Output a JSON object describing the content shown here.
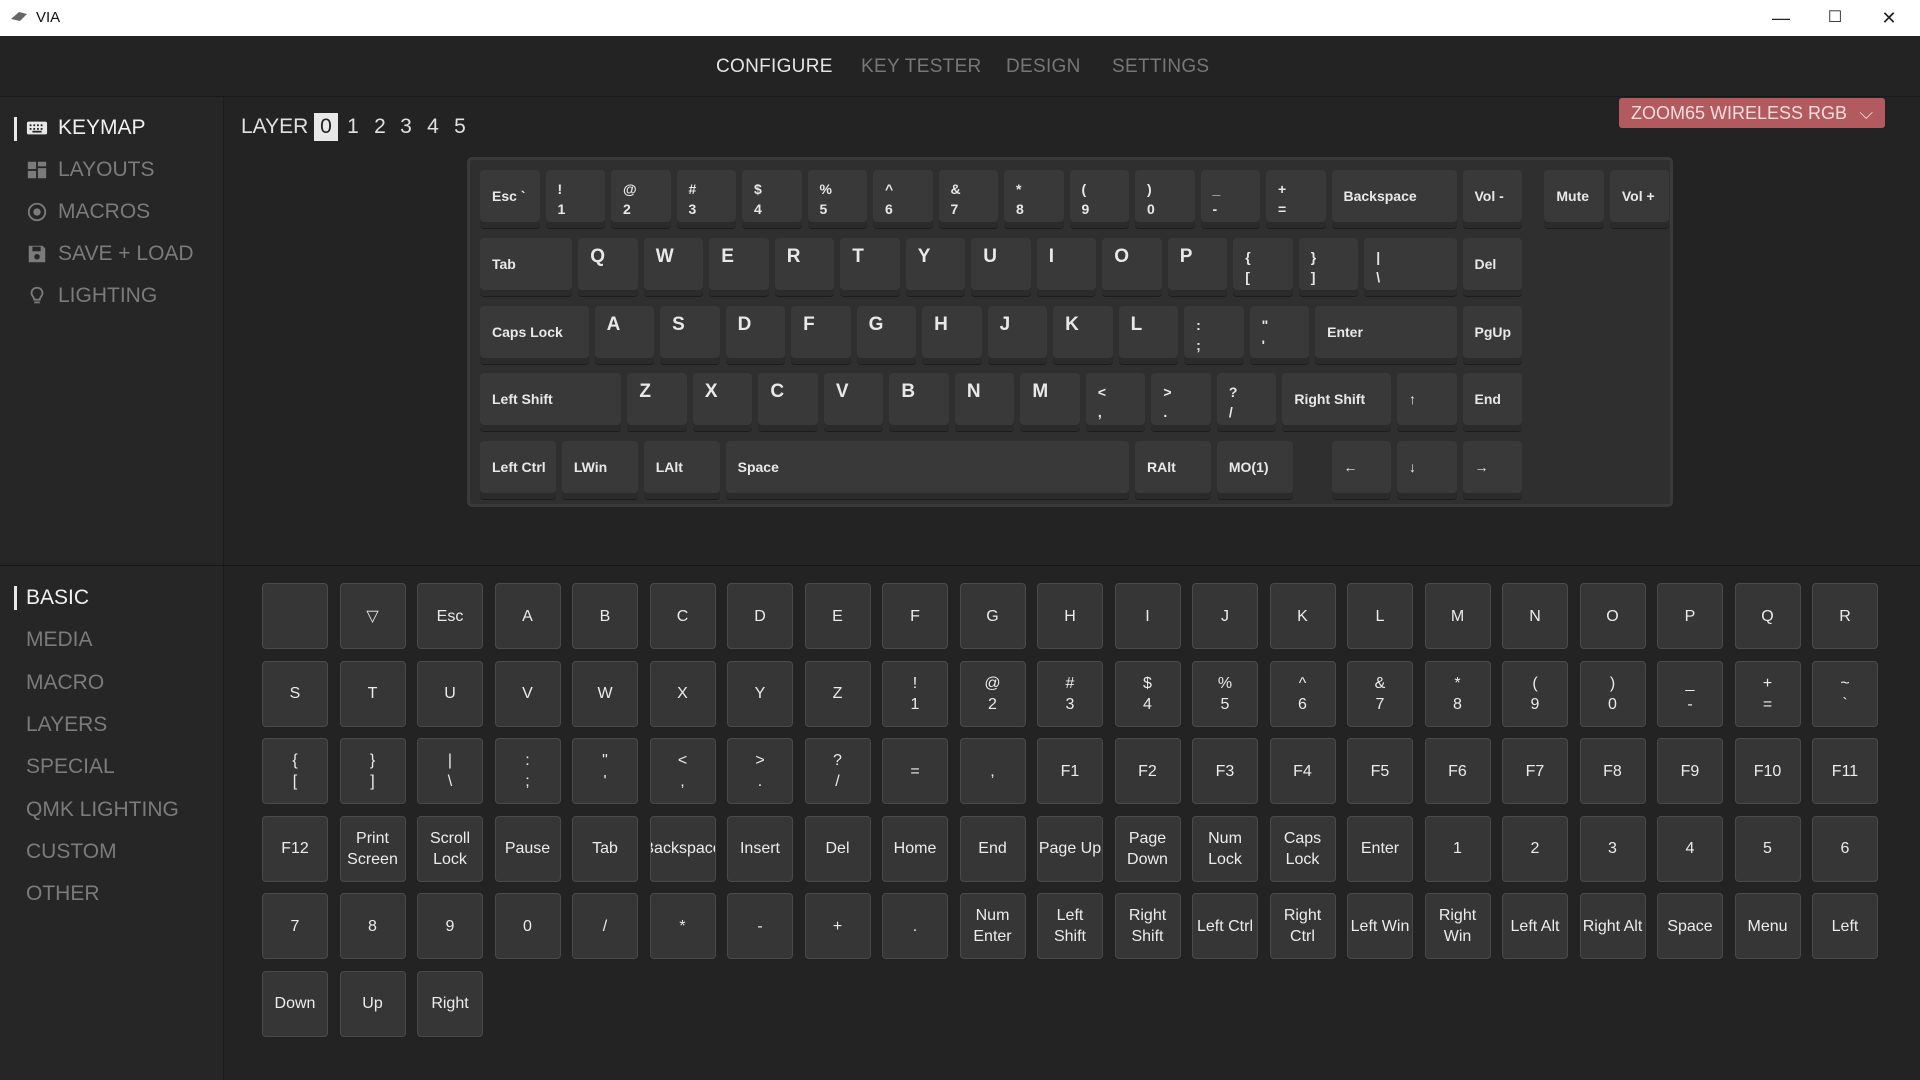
{
  "app": {
    "title": "VIA",
    "minimize": "—",
    "maximize": "☐",
    "close": "✕"
  },
  "nav": {
    "tabs": [
      "CONFIGURE",
      "KEY TESTER",
      "DESIGN",
      "SETTINGS"
    ],
    "active": 0
  },
  "sidebar": {
    "items": [
      {
        "label": "KEYMAP",
        "icon": "keyboard-icon"
      },
      {
        "label": "LAYOUTS",
        "icon": "layouts-icon"
      },
      {
        "label": "MACROS",
        "icon": "macros-icon"
      },
      {
        "label": "SAVE + LOAD",
        "icon": "save-icon"
      },
      {
        "label": "LIGHTING",
        "icon": "bulb-icon"
      }
    ],
    "active": 0
  },
  "layers": {
    "label": "LAYER",
    "numbers": [
      "0",
      "1",
      "2",
      "3",
      "4",
      "5"
    ],
    "active": 0
  },
  "device": {
    "name": "ZOOM65 WIRELESS RGB",
    "chevron": "⌵"
  },
  "keyboard": {
    "rows": [
      [
        {
          "t1": "Esc `",
          "w": 1
        },
        {
          "t1": "!",
          "t2": "1",
          "w": 1
        },
        {
          "t1": "@",
          "t2": "2",
          "w": 1
        },
        {
          "t1": "#",
          "t2": "3",
          "w": 1
        },
        {
          "t1": "$",
          "t2": "4",
          "w": 1
        },
        {
          "t1": "%",
          "t2": "5",
          "w": 1
        },
        {
          "t1": "^",
          "t2": "6",
          "w": 1
        },
        {
          "t1": "&",
          "t2": "7",
          "w": 1
        },
        {
          "t1": "*",
          "t2": "8",
          "w": 1
        },
        {
          "t1": "(",
          "t2": "9",
          "w": 1
        },
        {
          "t1": ")",
          "t2": "0",
          "w": 1
        },
        {
          "t1": "_",
          "t2": "-",
          "w": 1
        },
        {
          "t1": "+",
          "t2": "=",
          "w": 1
        },
        {
          "t1": "Backspace",
          "w": 2
        },
        {
          "t1": "Vol -",
          "w": 1
        },
        {
          "t1": "Mute",
          "w": 1,
          "gap": 0.25
        },
        {
          "t1": "Vol +",
          "w": 1
        }
      ],
      [
        {
          "t1": "Tab",
          "w": 1.5
        },
        {
          "t1": "Q",
          "big": true,
          "w": 1
        },
        {
          "t1": "W",
          "big": true,
          "w": 1
        },
        {
          "t1": "E",
          "big": true,
          "w": 1
        },
        {
          "t1": "R",
          "big": true,
          "w": 1
        },
        {
          "t1": "T",
          "big": true,
          "w": 1
        },
        {
          "t1": "Y",
          "big": true,
          "w": 1
        },
        {
          "t1": "U",
          "big": true,
          "w": 1
        },
        {
          "t1": "I",
          "big": true,
          "w": 1
        },
        {
          "t1": "O",
          "big": true,
          "w": 1
        },
        {
          "t1": "P",
          "big": true,
          "w": 1
        },
        {
          "t1": "{",
          "t2": "[",
          "w": 1
        },
        {
          "t1": "}",
          "t2": "]",
          "w": 1
        },
        {
          "t1": "|",
          "t2": "\\",
          "w": 1.5
        },
        {
          "t1": "Del",
          "w": 1
        }
      ],
      [
        {
          "t1": "Caps Lock",
          "w": 1.75
        },
        {
          "t1": "A",
          "big": true,
          "w": 1
        },
        {
          "t1": "S",
          "big": true,
          "w": 1
        },
        {
          "t1": "D",
          "big": true,
          "w": 1
        },
        {
          "t1": "F",
          "big": true,
          "w": 1
        },
        {
          "t1": "G",
          "big": true,
          "w": 1
        },
        {
          "t1": "H",
          "big": true,
          "w": 1
        },
        {
          "t1": "J",
          "big": true,
          "w": 1
        },
        {
          "t1": "K",
          "big": true,
          "w": 1
        },
        {
          "t1": "L",
          "big": true,
          "w": 1
        },
        {
          "t1": ":",
          "t2": ";",
          "w": 1
        },
        {
          "t1": "\"",
          "t2": "'",
          "w": 1
        },
        {
          "t1": "Enter",
          "w": 2.25
        },
        {
          "t1": "PgUp",
          "w": 1
        }
      ],
      [
        {
          "t1": "Left Shift",
          "w": 2.25
        },
        {
          "t1": "Z",
          "big": true,
          "w": 1
        },
        {
          "t1": "X",
          "big": true,
          "w": 1
        },
        {
          "t1": "C",
          "big": true,
          "w": 1
        },
        {
          "t1": "V",
          "big": true,
          "w": 1
        },
        {
          "t1": "B",
          "big": true,
          "w": 1
        },
        {
          "t1": "N",
          "big": true,
          "w": 1
        },
        {
          "t1": "M",
          "big": true,
          "w": 1
        },
        {
          "t1": "<",
          "t2": ",",
          "w": 1
        },
        {
          "t1": ">",
          "t2": ".",
          "w": 1
        },
        {
          "t1": "?",
          "t2": "/",
          "w": 1
        },
        {
          "t1": "Right Shift",
          "w": 1.75
        },
        {
          "t1": "↑",
          "w": 1
        },
        {
          "t1": "End",
          "w": 1
        }
      ],
      [
        {
          "t1": "Left Ctrl",
          "w": 1.25
        },
        {
          "t1": "LWin",
          "w": 1.25
        },
        {
          "t1": "LAlt",
          "w": 1.25
        },
        {
          "t1": "Space",
          "w": 6.25
        },
        {
          "t1": "RAlt",
          "w": 1.25
        },
        {
          "t1": "MO(1)",
          "w": 1.25
        },
        {
          "t1": "←",
          "w": 1,
          "gap": 0.5
        },
        {
          "t1": "↓",
          "w": 1
        },
        {
          "t1": "→",
          "w": 1
        }
      ]
    ]
  },
  "categories": {
    "items": [
      "BASIC",
      "MEDIA",
      "MACRO",
      "LAYERS",
      "SPECIAL",
      "QMK LIGHTING",
      "CUSTOM",
      "OTHER"
    ],
    "active": 0
  },
  "palette": [
    {
      "a": ""
    },
    {
      "a": "▽"
    },
    {
      "a": "Esc"
    },
    {
      "a": "A"
    },
    {
      "a": "B"
    },
    {
      "a": "C"
    },
    {
      "a": "D"
    },
    {
      "a": "E"
    },
    {
      "a": "F"
    },
    {
      "a": "G"
    },
    {
      "a": "H"
    },
    {
      "a": "I"
    },
    {
      "a": "J"
    },
    {
      "a": "K"
    },
    {
      "a": "L"
    },
    {
      "a": "M"
    },
    {
      "a": "N"
    },
    {
      "a": "O"
    },
    {
      "a": "P"
    },
    {
      "a": "Q"
    },
    {
      "a": "R"
    },
    {
      "a": "S"
    },
    {
      "a": "T"
    },
    {
      "a": "U"
    },
    {
      "a": "V"
    },
    {
      "a": "W"
    },
    {
      "a": "X"
    },
    {
      "a": "Y"
    },
    {
      "a": "Z"
    },
    {
      "a": "!",
      "b": "1"
    },
    {
      "a": "@",
      "b": "2"
    },
    {
      "a": "#",
      "b": "3"
    },
    {
      "a": "$",
      "b": "4"
    },
    {
      "a": "%",
      "b": "5"
    },
    {
      "a": "^",
      "b": "6"
    },
    {
      "a": "&",
      "b": "7"
    },
    {
      "a": "*",
      "b": "8"
    },
    {
      "a": "(",
      "b": "9"
    },
    {
      "a": ")",
      "b": "0"
    },
    {
      "a": "_",
      "b": "-"
    },
    {
      "a": "+",
      "b": "="
    },
    {
      "a": "~",
      "b": "`"
    },
    {
      "a": "{",
      "b": "["
    },
    {
      "a": "}",
      "b": "]"
    },
    {
      "a": "|",
      "b": "\\"
    },
    {
      "a": ":",
      "b": ";"
    },
    {
      "a": "\"",
      "b": "'"
    },
    {
      "a": "<",
      "b": ","
    },
    {
      "a": ">",
      "b": "."
    },
    {
      "a": "?",
      "b": "/"
    },
    {
      "a": "="
    },
    {
      "a": ","
    },
    {
      "a": "F1"
    },
    {
      "a": "F2"
    },
    {
      "a": "F3"
    },
    {
      "a": "F4"
    },
    {
      "a": "F5"
    },
    {
      "a": "F6"
    },
    {
      "a": "F7"
    },
    {
      "a": "F8"
    },
    {
      "a": "F9"
    },
    {
      "a": "F10"
    },
    {
      "a": "F11"
    },
    {
      "a": "F12"
    },
    {
      "a": "Print",
      "b": "Screen"
    },
    {
      "a": "Scroll",
      "b": "Lock"
    },
    {
      "a": "Pause"
    },
    {
      "a": "Tab"
    },
    {
      "a": "Backspace"
    },
    {
      "a": "Insert"
    },
    {
      "a": "Del"
    },
    {
      "a": "Home"
    },
    {
      "a": "End"
    },
    {
      "a": "Page Up"
    },
    {
      "a": "Page",
      "b": "Down"
    },
    {
      "a": "Num",
      "b": "Lock"
    },
    {
      "a": "Caps",
      "b": "Lock"
    },
    {
      "a": "Enter"
    },
    {
      "a": "1"
    },
    {
      "a": "2"
    },
    {
      "a": "3"
    },
    {
      "a": "4"
    },
    {
      "a": "5"
    },
    {
      "a": "6"
    },
    {
      "a": "7"
    },
    {
      "a": "8"
    },
    {
      "a": "9"
    },
    {
      "a": "0"
    },
    {
      "a": "/"
    },
    {
      "a": "*"
    },
    {
      "a": "-"
    },
    {
      "a": "+"
    },
    {
      "a": "."
    },
    {
      "a": "Num",
      "b": "Enter"
    },
    {
      "a": "Left",
      "b": "Shift"
    },
    {
      "a": "Right",
      "b": "Shift"
    },
    {
      "a": "Left Ctrl"
    },
    {
      "a": "Right",
      "b": "Ctrl"
    },
    {
      "a": "Left Win"
    },
    {
      "a": "Right",
      "b": "Win"
    },
    {
      "a": "Left Alt"
    },
    {
      "a": "Right Alt"
    },
    {
      "a": "Space"
    },
    {
      "a": "Menu"
    },
    {
      "a": "Left"
    },
    {
      "a": "Down"
    },
    {
      "a": "Up"
    },
    {
      "a": "Right"
    }
  ],
  "colors": {
    "accent": "#b25a5e",
    "background": "#232323",
    "key": "#393939"
  }
}
